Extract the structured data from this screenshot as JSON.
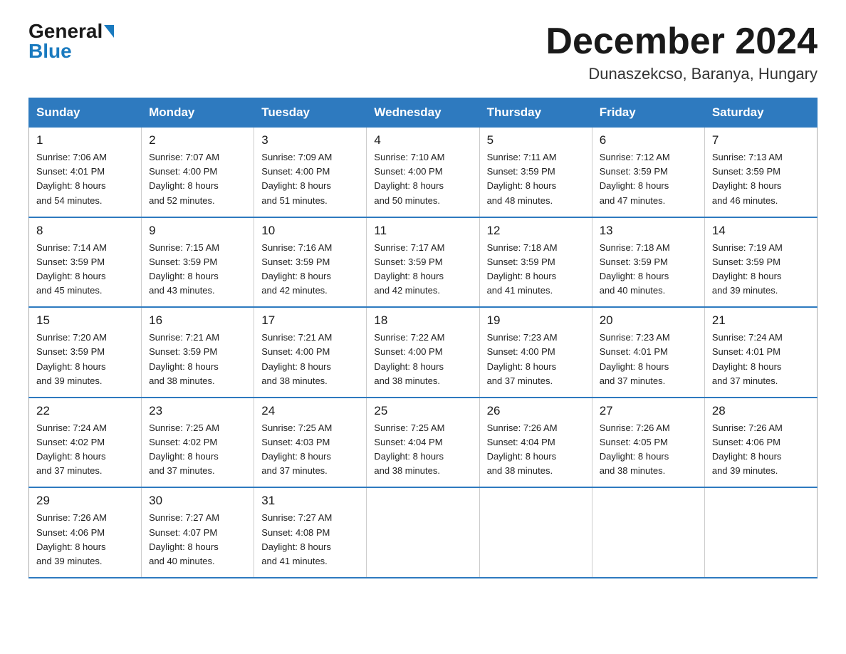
{
  "logo": {
    "general": "General",
    "triangle": "▶",
    "blue": "Blue"
  },
  "title": "December 2024",
  "location": "Dunaszekcso, Baranya, Hungary",
  "days_of_week": [
    "Sunday",
    "Monday",
    "Tuesday",
    "Wednesday",
    "Thursday",
    "Friday",
    "Saturday"
  ],
  "weeks": [
    [
      {
        "day": "1",
        "sunrise": "7:06 AM",
        "sunset": "4:01 PM",
        "daylight": "8 hours and 54 minutes."
      },
      {
        "day": "2",
        "sunrise": "7:07 AM",
        "sunset": "4:00 PM",
        "daylight": "8 hours and 52 minutes."
      },
      {
        "day": "3",
        "sunrise": "7:09 AM",
        "sunset": "4:00 PM",
        "daylight": "8 hours and 51 minutes."
      },
      {
        "day": "4",
        "sunrise": "7:10 AM",
        "sunset": "4:00 PM",
        "daylight": "8 hours and 50 minutes."
      },
      {
        "day": "5",
        "sunrise": "7:11 AM",
        "sunset": "3:59 PM",
        "daylight": "8 hours and 48 minutes."
      },
      {
        "day": "6",
        "sunrise": "7:12 AM",
        "sunset": "3:59 PM",
        "daylight": "8 hours and 47 minutes."
      },
      {
        "day": "7",
        "sunrise": "7:13 AM",
        "sunset": "3:59 PM",
        "daylight": "8 hours and 46 minutes."
      }
    ],
    [
      {
        "day": "8",
        "sunrise": "7:14 AM",
        "sunset": "3:59 PM",
        "daylight": "8 hours and 45 minutes."
      },
      {
        "day": "9",
        "sunrise": "7:15 AM",
        "sunset": "3:59 PM",
        "daylight": "8 hours and 43 minutes."
      },
      {
        "day": "10",
        "sunrise": "7:16 AM",
        "sunset": "3:59 PM",
        "daylight": "8 hours and 42 minutes."
      },
      {
        "day": "11",
        "sunrise": "7:17 AM",
        "sunset": "3:59 PM",
        "daylight": "8 hours and 42 minutes."
      },
      {
        "day": "12",
        "sunrise": "7:18 AM",
        "sunset": "3:59 PM",
        "daylight": "8 hours and 41 minutes."
      },
      {
        "day": "13",
        "sunrise": "7:18 AM",
        "sunset": "3:59 PM",
        "daylight": "8 hours and 40 minutes."
      },
      {
        "day": "14",
        "sunrise": "7:19 AM",
        "sunset": "3:59 PM",
        "daylight": "8 hours and 39 minutes."
      }
    ],
    [
      {
        "day": "15",
        "sunrise": "7:20 AM",
        "sunset": "3:59 PM",
        "daylight": "8 hours and 39 minutes."
      },
      {
        "day": "16",
        "sunrise": "7:21 AM",
        "sunset": "3:59 PM",
        "daylight": "8 hours and 38 minutes."
      },
      {
        "day": "17",
        "sunrise": "7:21 AM",
        "sunset": "4:00 PM",
        "daylight": "8 hours and 38 minutes."
      },
      {
        "day": "18",
        "sunrise": "7:22 AM",
        "sunset": "4:00 PM",
        "daylight": "8 hours and 38 minutes."
      },
      {
        "day": "19",
        "sunrise": "7:23 AM",
        "sunset": "4:00 PM",
        "daylight": "8 hours and 37 minutes."
      },
      {
        "day": "20",
        "sunrise": "7:23 AM",
        "sunset": "4:01 PM",
        "daylight": "8 hours and 37 minutes."
      },
      {
        "day": "21",
        "sunrise": "7:24 AM",
        "sunset": "4:01 PM",
        "daylight": "8 hours and 37 minutes."
      }
    ],
    [
      {
        "day": "22",
        "sunrise": "7:24 AM",
        "sunset": "4:02 PM",
        "daylight": "8 hours and 37 minutes."
      },
      {
        "day": "23",
        "sunrise": "7:25 AM",
        "sunset": "4:02 PM",
        "daylight": "8 hours and 37 minutes."
      },
      {
        "day": "24",
        "sunrise": "7:25 AM",
        "sunset": "4:03 PM",
        "daylight": "8 hours and 37 minutes."
      },
      {
        "day": "25",
        "sunrise": "7:25 AM",
        "sunset": "4:04 PM",
        "daylight": "8 hours and 38 minutes."
      },
      {
        "day": "26",
        "sunrise": "7:26 AM",
        "sunset": "4:04 PM",
        "daylight": "8 hours and 38 minutes."
      },
      {
        "day": "27",
        "sunrise": "7:26 AM",
        "sunset": "4:05 PM",
        "daylight": "8 hours and 38 minutes."
      },
      {
        "day": "28",
        "sunrise": "7:26 AM",
        "sunset": "4:06 PM",
        "daylight": "8 hours and 39 minutes."
      }
    ],
    [
      {
        "day": "29",
        "sunrise": "7:26 AM",
        "sunset": "4:06 PM",
        "daylight": "8 hours and 39 minutes."
      },
      {
        "day": "30",
        "sunrise": "7:27 AM",
        "sunset": "4:07 PM",
        "daylight": "8 hours and 40 minutes."
      },
      {
        "day": "31",
        "sunrise": "7:27 AM",
        "sunset": "4:08 PM",
        "daylight": "8 hours and 41 minutes."
      },
      null,
      null,
      null,
      null
    ]
  ],
  "labels": {
    "sunrise": "Sunrise:",
    "sunset": "Sunset:",
    "daylight": "Daylight:"
  }
}
